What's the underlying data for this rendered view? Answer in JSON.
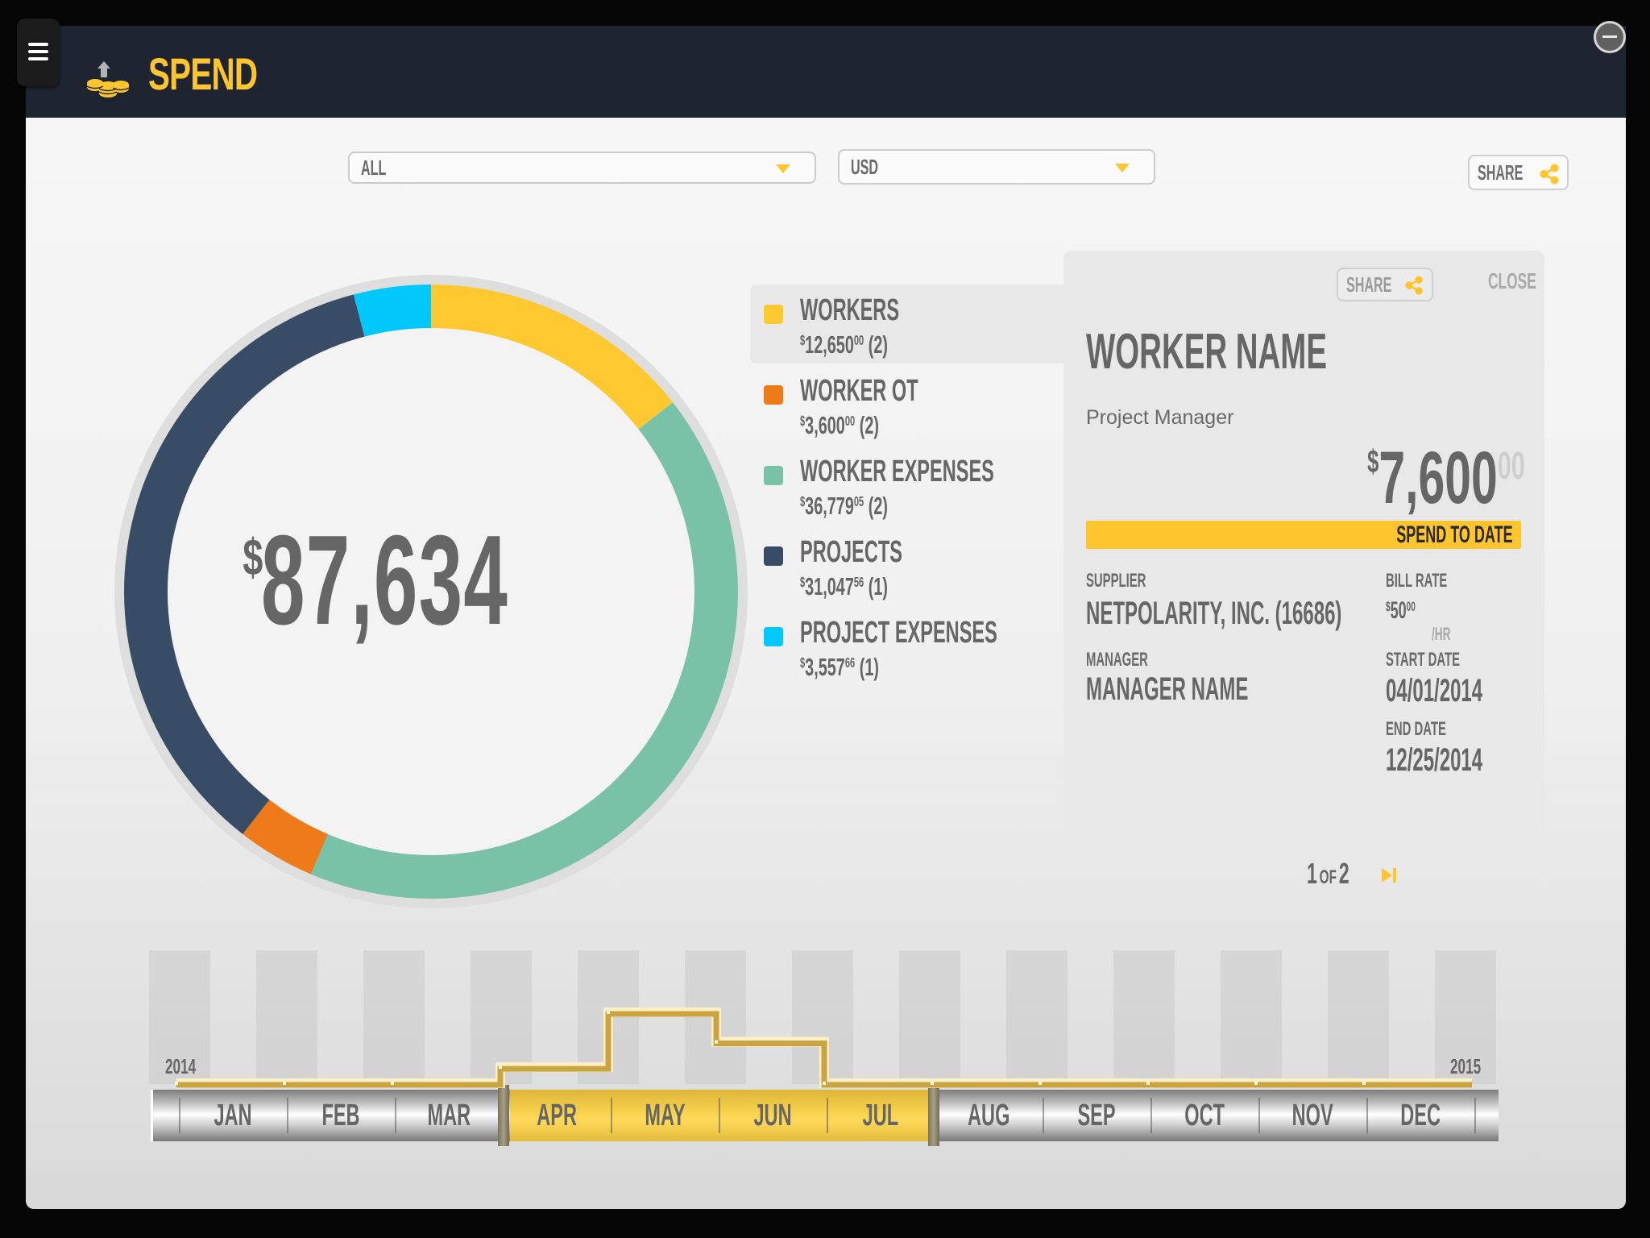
{
  "header": {
    "title": "SPEND",
    "menu_icon": "hamburger-icon",
    "app_icon": "coins-upload-icon",
    "minimize_icon": "minus-circle-icon"
  },
  "filters": {
    "scope": {
      "selected": "ALL"
    },
    "currency": {
      "selected": "USD"
    }
  },
  "share_label": "SHARE",
  "summary": {
    "currency_symbol": "$",
    "total": "87,634"
  },
  "legend": [
    {
      "label": "WORKERS",
      "amount": "12,650",
      "cents": "00",
      "count": "(2)",
      "color": "#fec930",
      "selected": true
    },
    {
      "label": "WORKER OT",
      "amount": "3,600",
      "cents": "00",
      "count": "(2)",
      "color": "#ef7a1a",
      "selected": false
    },
    {
      "label": "WORKER EXPENSES",
      "amount": "36,779",
      "cents": "05",
      "count": "(2)",
      "color": "#79c2a8",
      "selected": false
    },
    {
      "label": "PROJECTS",
      "amount": "31,047",
      "cents": "56",
      "count": "(1)",
      "color": "#384d65",
      "selected": false
    },
    {
      "label": "PROJECT EXPENSES",
      "amount": "3,557",
      "cents": "66",
      "count": "(1)",
      "color": "#00c8fa",
      "selected": false
    }
  ],
  "chart_data": [
    {
      "type": "pie",
      "variant": "donut",
      "title": "",
      "center_label": "$87,634",
      "order": "clockwise from top",
      "categories": [
        "WORKERS",
        "WORKER EXPENSES",
        "WORKER OT",
        "PROJECTS",
        "PROJECT EXPENSES"
      ],
      "values": [
        12650.0,
        36779.05,
        3600.0,
        31047.56,
        3557.66
      ],
      "colors": [
        "#fec930",
        "#79c2a8",
        "#ef7a1a",
        "#384d65",
        "#00c8fa"
      ]
    },
    {
      "type": "line",
      "variant": "step",
      "title": "",
      "categories": [
        "JAN",
        "FEB",
        "MAR",
        "APR",
        "MAY",
        "JUN",
        "JUL",
        "AUG",
        "SEP",
        "OCT",
        "NOV",
        "DEC"
      ],
      "values": [
        0,
        0,
        0,
        0.12,
        0.53,
        0.31,
        0,
        0,
        0,
        0,
        0,
        0
      ],
      "value_units": "relative spend level (fraction of max track height, estimated)",
      "start_label": "2014",
      "end_label": "2015",
      "selected_range": [
        "APR",
        "JUL"
      ],
      "grid": "vertical column bands",
      "color": "#c9a441"
    }
  ],
  "detail": {
    "share_label": "SHARE",
    "close_label": "CLOSE",
    "name": "WORKER NAME",
    "role": "Project Manager",
    "spend": {
      "currency": "$",
      "amount": "7,600",
      "cents": "00"
    },
    "spend_label": "SPEND TO DATE",
    "supplier_label": "SUPPLIER",
    "supplier": "NETPOLARITY, INC. (16686)",
    "bill_rate_label": "BILL RATE",
    "bill_rate": {
      "currency": "$",
      "amount": "50",
      "cents": "00",
      "unit": "/HR"
    },
    "manager_label": "MANAGER",
    "manager": "MANAGER NAME",
    "start_date_label": "START DATE",
    "start_date": "04/01/2014",
    "end_date_label": "END DATE",
    "end_date": "12/25/2014",
    "pager": {
      "current": "1",
      "of": "OF",
      "total": "2"
    }
  },
  "colors": {
    "accent": "#fec52e",
    "header_bg": "#1f2530",
    "text": "#666666"
  }
}
